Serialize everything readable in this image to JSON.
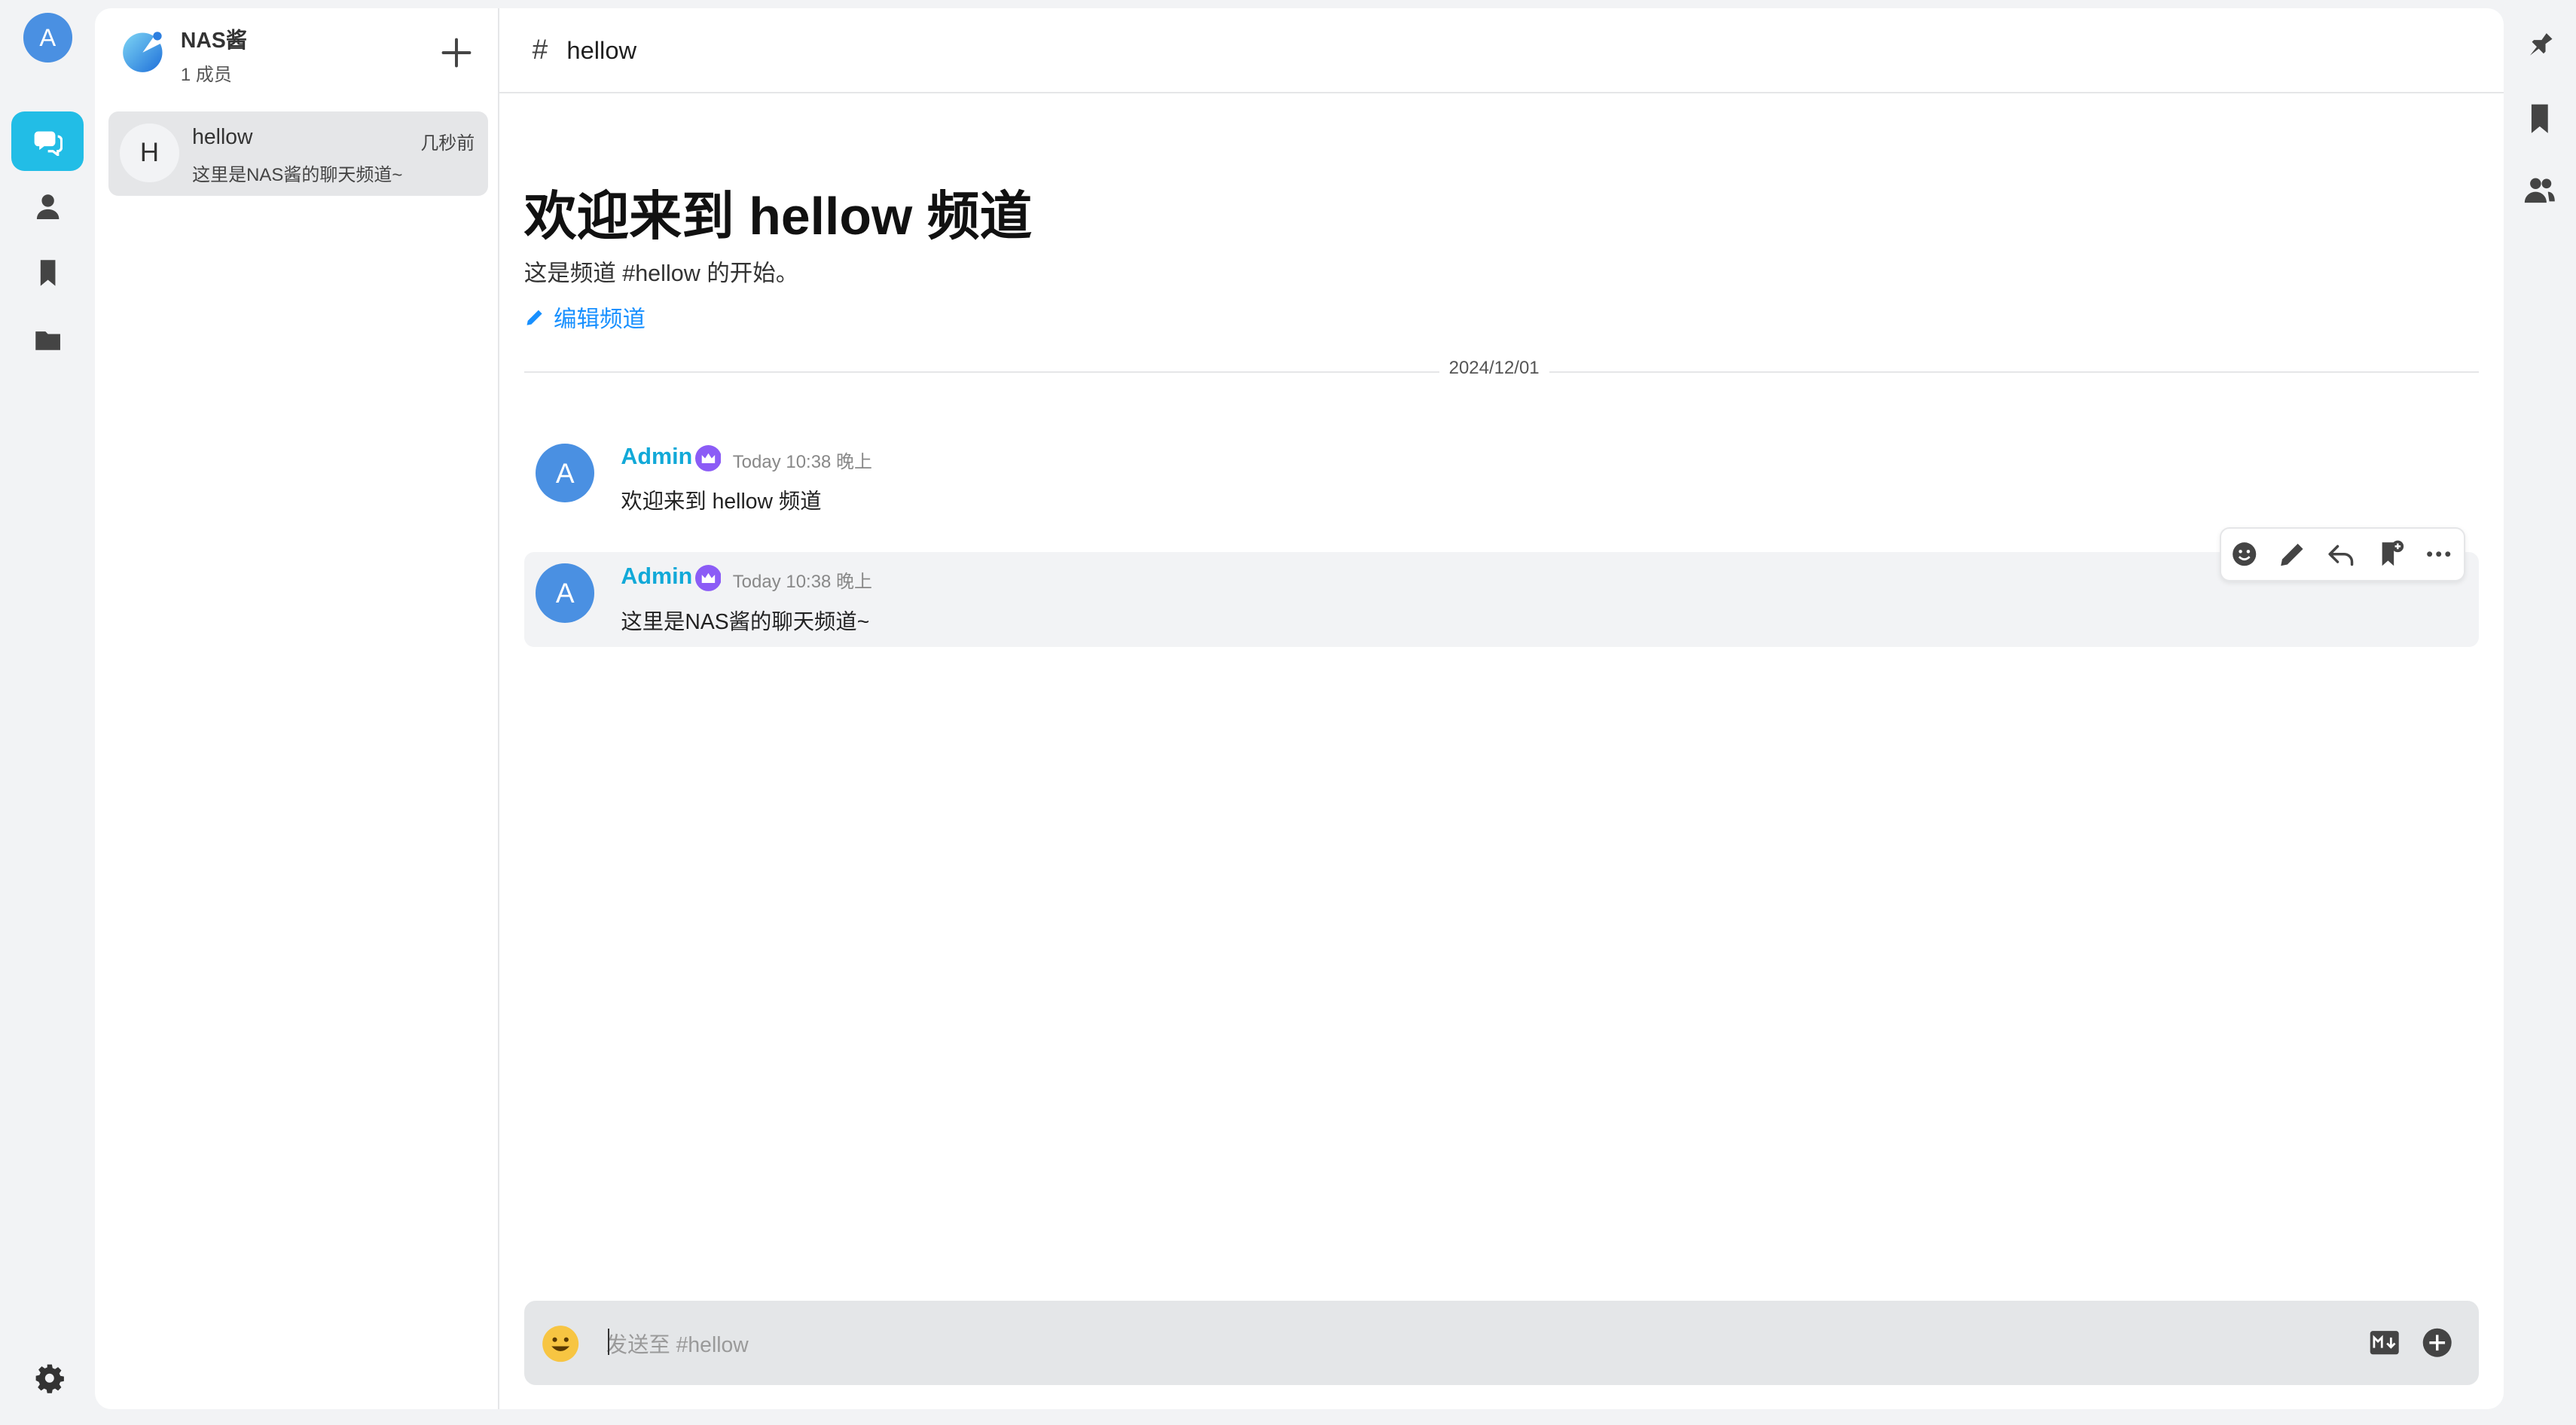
{
  "user": {
    "avatar_letter": "A"
  },
  "nav": {
    "items": [
      "chat-icon",
      "user-icon",
      "bookmark-icon",
      "folder-icon"
    ],
    "active": "chat-icon"
  },
  "group": {
    "name": "NAS酱",
    "member_count": "1 成员"
  },
  "conversations": [
    {
      "avatar": "H",
      "name": "hellow",
      "time": "几秒前",
      "preview": "这里是NAS酱的聊天频道~"
    }
  ],
  "channel": {
    "hash": "#",
    "name": "hellow",
    "welcome_title": "欢迎来到 hellow 频道",
    "welcome_sub": "这是频道 #hellow 的开始。",
    "edit_label": "编辑频道",
    "date_divider": "2024/12/01"
  },
  "messages": [
    {
      "avatar": "A",
      "author": "Admin",
      "time": "Today 10:38 晚上",
      "text": "欢迎来到 hellow 频道"
    },
    {
      "avatar": "A",
      "author": "Admin",
      "time": "Today 10:38 晚上",
      "text": "这里是NAS酱的聊天频道~"
    }
  ],
  "message_actions": [
    "emoji-reaction-icon",
    "edit-icon",
    "reply-icon",
    "bookmark-add-icon",
    "more-icon"
  ],
  "composer": {
    "placeholder": "发送至 #hellow",
    "value": ""
  },
  "right_rail": [
    "pin-icon",
    "bookmark-icon",
    "members-icon"
  ],
  "colors": {
    "accent": "#22bde6",
    "author": "#12a9d8",
    "link": "#1890ff",
    "avatar": "#4a90e2",
    "crown": "#8b5cf6"
  }
}
